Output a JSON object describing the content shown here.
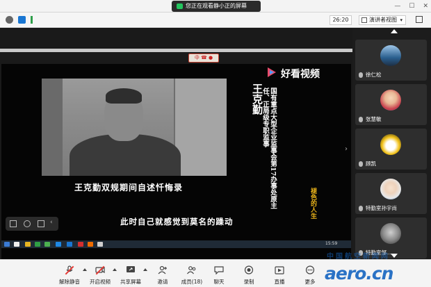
{
  "titlebar": {
    "share_text": "您正在观看静小正的屏幕"
  },
  "infobar": {
    "timer": "26:20",
    "view_button": "演讲者视图"
  },
  "share": {
    "remote_window_title": "中 ☎ ●",
    "brand_text": "好看视频",
    "name_vertical": "王克勤",
    "title_vertical": "国有重点大型企业监事会第17办事处原主任、正局级专职监事",
    "caption_top": "王克勤双规期间自述忏悔录",
    "caption_bottom": "此时自己就感觉到莫名的躁动",
    "side_tag": "褪色的人生",
    "remote_clock": "15:59"
  },
  "participants": [
    {
      "name": "徐仁松",
      "avatar_color": "#2a5f8f"
    },
    {
      "name": "张慧敏",
      "avatar_color": "#c63a4a"
    },
    {
      "name": "顾凯",
      "avatar_color": "#f2c21b"
    },
    {
      "name": "特勤室孙宇尚",
      "avatar_color": "#3d7cc9"
    },
    {
      "name": "特勤室邹...",
      "avatar_color": "#6a6a6a"
    }
  ],
  "bottombar": {
    "mute": "解除静音",
    "video": "开启视频",
    "share": "共享屏幕",
    "invite": "邀请",
    "members": "成员(18)",
    "chat": "聊天",
    "record": "录制",
    "live": "直播",
    "more": "更多"
  },
  "watermark": {
    "text": "aero.cn",
    "sub": "中国航空新闻网"
  },
  "colors": {
    "accent_green": "#23c55e",
    "mute_red": "#e53935",
    "watermark_blue": "#1565c0"
  }
}
